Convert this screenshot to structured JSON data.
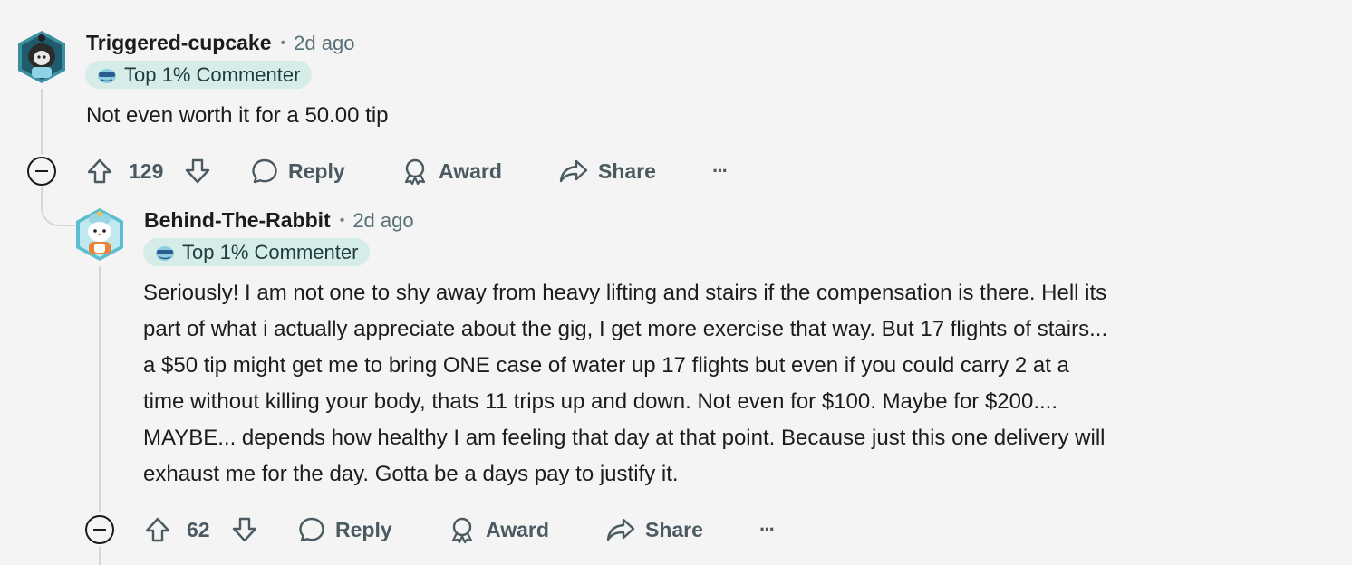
{
  "comments": [
    {
      "username": "Triggered-cupcake",
      "time": "2d ago",
      "badge": "Top 1% Commenter",
      "body": "Not even worth it for a 50.00 tip",
      "votes": "129",
      "actions": {
        "reply": "Reply",
        "award": "Award",
        "share": "Share",
        "more": "···"
      }
    },
    {
      "username": "Behind-The-Rabbit",
      "time": "2d ago",
      "badge": "Top 1% Commenter",
      "body_lines": [
        "Seriously! I am not one to shy away from heavy lifting and stairs if the compensation is there. Hell its",
        "part of what i actually appreciate about the gig, I get more exercise that way. But 17 flights of stairs...",
        "a $50 tip might get me to bring ONE case of water up 17 flights but even if you could carry 2 at a",
        "time without killing your body, thats 11 trips up and down. Not even for $100. Maybe for $200....",
        "MAYBE... depends how healthy I am feeling that day at that point. Because just this one delivery will",
        "exhaust me for the day. Gotta be a days pay to justify it."
      ],
      "votes": "62",
      "actions": {
        "reply": "Reply",
        "award": "Award",
        "share": "Share",
        "more": "···"
      }
    }
  ],
  "colors": {
    "background": "#f4f4f4",
    "badge_bg": "#d6ece8",
    "meta_gray": "#576f76"
  }
}
